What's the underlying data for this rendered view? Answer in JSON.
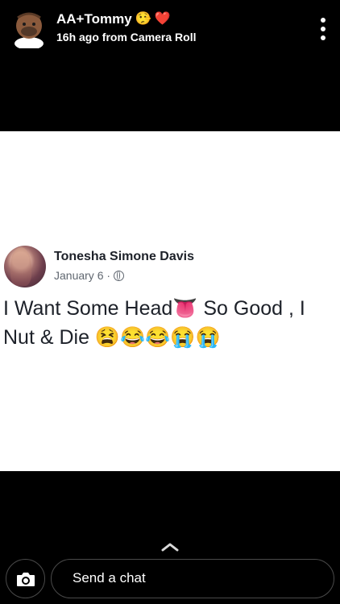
{
  "story": {
    "title": "AA+Tommy",
    "title_emojis": [
      "🤥",
      "❤️"
    ],
    "subtitle": "16h ago from Camera Roll"
  },
  "post": {
    "author": "Tonesha Simone Davis",
    "date": "January 6 ·",
    "text": "I Want Some Head👅 So Good , I Nut & Die 😫😂😂😭😭"
  },
  "chat": {
    "placeholder": "Send a chat"
  },
  "icons": {
    "menu": "more-vertical-icon",
    "globe": "globe-icon",
    "camera": "camera-icon",
    "chevron": "chevron-up-icon"
  }
}
